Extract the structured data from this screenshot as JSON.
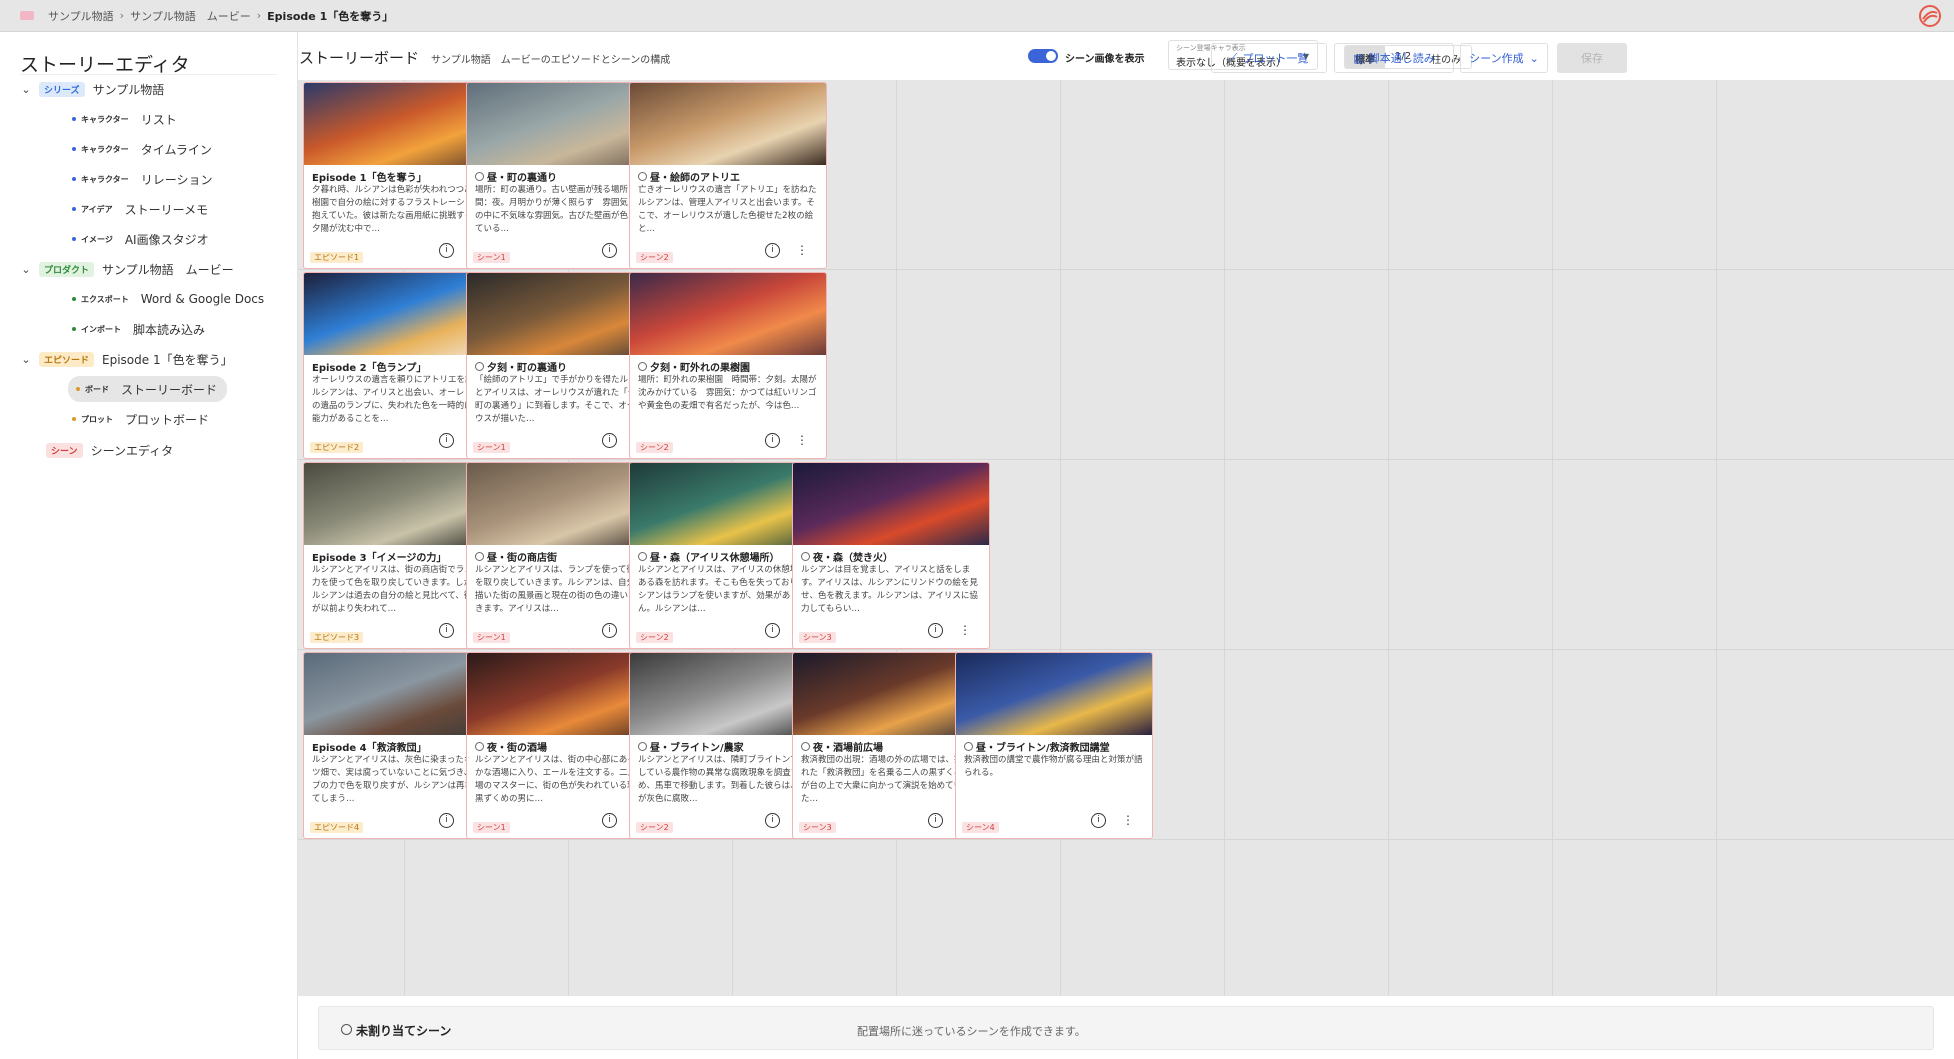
{
  "breadcrumb": [
    "サンプル物語",
    "サンプル物語　ムービー",
    "Episode 1「色を奪う」"
  ],
  "sidebar": {
    "title": "ストーリーエディタ",
    "items": [
      {
        "tag": "シリーズ",
        "label": "サンプル物語"
      },
      {
        "tag": "キャラクター",
        "label": "リスト"
      },
      {
        "tag": "キャラクター",
        "label": "タイムライン"
      },
      {
        "tag": "キャラクター",
        "label": "リレーション"
      },
      {
        "tag": "アイデア",
        "label": "ストーリーメモ"
      },
      {
        "tag": "イメージ",
        "label": "AI画像スタジオ"
      },
      {
        "tag": "プロダクト",
        "label": "サンプル物語　ムービー"
      },
      {
        "tag": "エクスポート",
        "label": "Word & Google Docs"
      },
      {
        "tag": "インポート",
        "label": "脚本読み込み"
      },
      {
        "tag": "エピソード",
        "label": "Episode 1「色を奪う」"
      },
      {
        "tag": "ボード",
        "label": "ストーリーボード"
      },
      {
        "tag": "プロット",
        "label": "プロットボード"
      },
      {
        "tag": "シーン",
        "label": "シーンエディタ"
      }
    ]
  },
  "header": {
    "title": "ストーリーボード",
    "subtitle": "サンプル物語　ムービーのエピソードとシーンの構成",
    "toggle_label": "シーン画像を表示",
    "select_caption": "シーン登場キャラ表示",
    "select_value": "表示なし（概要を表示）",
    "segments": [
      "標準",
      "1/2",
      "柱のみ"
    ],
    "plot_button": "プロット一覧",
    "script_button": "脚本通し読み",
    "create_button": "シーン作成",
    "save_button": "保存"
  },
  "cards": [
    {
      "title": "Episode 1「色を奪う」",
      "body": "夕暮れ時、ルシアンは色彩が失われつつある果樹園で自分の絵に対するフラストレーションを抱えていた。彼は新たな画用紙に挑戦するが、夕陽が沈む中で…",
      "badge": "エピソード1",
      "img": [
        "#2b3a6a",
        "#c9592b",
        "#f2a23c",
        "#5a3a2a"
      ]
    },
    {
      "title": "昼・町の裏通り",
      "body": "場所：町の裏通り。古い壁画が残る場所　時間：夜。月明かりが薄く照らす　雰囲気：静寂の中に不気味な雰囲気。古びた壁画が色を失っている…",
      "badge": "シーン1",
      "img": [
        "#5f6e7a",
        "#9aa7a8",
        "#c8b79a",
        "#6b5a4c"
      ]
    },
    {
      "title": "昼・絵師のアトリエ",
      "body": "亡きオーレリウスの遺言「アトリエ」を訪ねたルシアンは、管理人アイリスと出会います。そこで、オーレリウスが遺した色褪せた2枚の絵と…",
      "badge": "シーン2",
      "img": [
        "#6a4a36",
        "#c89a6a",
        "#e8d3b0",
        "#3b2a20"
      ]
    },
    {
      "title": "Episode 2「色ランプ」",
      "body": "オーレリウスの遺言を頼りにアトリエを訪れたルシアンは、アイリスと出会い、オーレリウスの遺品のランプに、失われた色を一時的に戻す能力があることを…",
      "badge": "エピソード2",
      "img": [
        "#1d1f3a",
        "#2f7fd6",
        "#e8b15a",
        "#f3e6d3"
      ]
    },
    {
      "title": "夕刻・町の裏通り",
      "body": "「絵師のアトリエ」で手がかりを得たルシアンとアイリスは、オーレリウスが遺れた「夕刻・町の裏通り」に到着します。そこで、オーレリウスが描いた…",
      "badge": "シーン1",
      "img": [
        "#2a2a2a",
        "#7a5a3a",
        "#d9873a",
        "#3e3a36"
      ]
    },
    {
      "title": "夕刻・町外れの果樹園",
      "body": "場所：町外れの果樹園　時間帯：夕刻。太陽が沈みかけている　雰囲気：かつては紅いリンゴや黄金色の麦畑で有名だったが、今は色…",
      "badge": "シーン2",
      "img": [
        "#3a2a4a",
        "#c9473a",
        "#f08a4a",
        "#6a3a3a"
      ]
    },
    {
      "title": "Episode 3「イメージの力」",
      "body": "ルシアンとアイリスは、街の商店街でランプの力を使って色を取り戻していきます。しかし、ルシアンは過去の自分の絵と見比べて、街の色が以前より失われて…",
      "badge": "エピソード3",
      "img": [
        "#4a4a40",
        "#8a8a78",
        "#c8c2a8",
        "#2a2a26"
      ]
    },
    {
      "title": "昼・街の商店街",
      "body": "ルシアンとアイリスは、ランプを使って街の色を取り戻していきます。ルシアンは、自分が昔描いた街の風景画と現在の街の色の違いに気付きます。アイリスは…",
      "badge": "シーン1",
      "img": [
        "#6a5a4a",
        "#a8927a",
        "#d8c6a8",
        "#3a302a"
      ]
    },
    {
      "title": "昼・森（アイリス休憩場所）",
      "body": "ルシアンとアイリスは、アイリスの休憩場所である森を訪れます。そこも色を失っており、ルシアンはランプを使いますが、効果がありません。ルシアンは…",
      "badge": "シーン2",
      "img": [
        "#1f3a3a",
        "#3a7a6a",
        "#e8c24a",
        "#2a4a3a"
      ]
    },
    {
      "title": "夜・森（焚き火）",
      "body": "ルシアンは目を覚まし、アイリスと話をします。アイリスは、ルシアンにリンドウの絵を見せ、色を教えます。ルシアンは、アイリスに協力してもらい…",
      "badge": "シーン3",
      "img": [
        "#1a1a3a",
        "#5a2a5a",
        "#d94a2a",
        "#2a2a4a"
      ]
    },
    {
      "title": "Episode 4「救済教団」",
      "body": "ルシアンとアイリスは、灰色に染まったキャベツ畑で、実は腐っていないことに気づき、ランプの力で色を取り戻すが、ルシアンは再び倒れてしまう…",
      "badge": "エピソード4",
      "img": [
        "#5a6a7a",
        "#8a96a0",
        "#6a4a3a",
        "#3a3a3a"
      ]
    },
    {
      "title": "夜・街の酒場",
      "body": "ルシアンとアイリスは、街の中心部にある賑やかな酒場に入り、エールを注文する。二人は酒場のマスターに、街の色が失われている現象と黒ずくめの男に…",
      "badge": "シーン1",
      "img": [
        "#2a1a1a",
        "#8a3a2a",
        "#e88a3a",
        "#4a2a20"
      ]
    },
    {
      "title": "昼・ブライトン/農家",
      "body": "ルシアンとアイリスは、隣町ブライトンで発生している農作物の異常な腐敗現象を調査するため、馬車で移動します。到着した彼らは、一面が灰色に腐敗…",
      "badge": "シーン2",
      "img": [
        "#3a3a3a",
        "#8a8a8a",
        "#c8c8c8",
        "#2a2a2a"
      ]
    },
    {
      "title": "夜・酒場前広場",
      "body": "救済教団の出現：酒場の外の広場では、突如現れた「救済教団」を名乗る二人の黒ずくめの男が台の上で大衆に向かって演説を始めていました…",
      "badge": "シーン3",
      "img": [
        "#1a1a2a",
        "#6a3a2a",
        "#e8a24a",
        "#2a2a3a"
      ]
    },
    {
      "title": "昼・ブライトン/救済教団講堂",
      "body": "救済教団の講堂で農作物が腐る理由と対策が語られる。",
      "badge": "シーン4",
      "img": [
        "#1a2a5a",
        "#3a5aa8",
        "#e8b84a",
        "#2a2040"
      ]
    }
  ],
  "unassigned": {
    "label": "未割り当てシーン",
    "message": "配置場所に迷っているシーンを作成できます。"
  }
}
